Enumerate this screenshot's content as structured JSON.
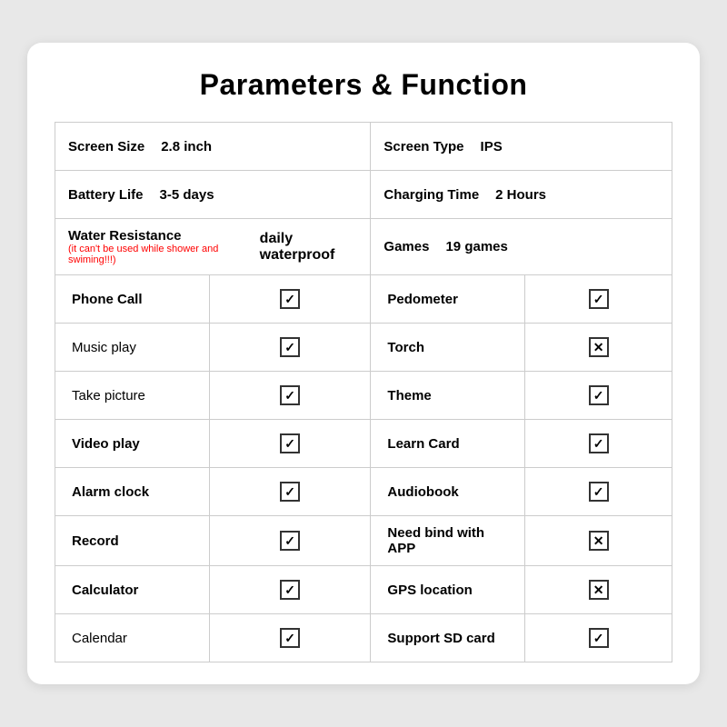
{
  "title": "Parameters & Function",
  "params": [
    {
      "left_label": "Screen Size",
      "left_value": "2.8 inch",
      "right_label": "Screen Type",
      "right_value": "IPS"
    },
    {
      "left_label": "Battery Life",
      "left_value": "3-5 days",
      "right_label": "Charging Time",
      "right_value": "2 Hours"
    },
    {
      "left_label": "Water Resistance",
      "left_value": "daily waterproof",
      "left_note": "(it can't be used while shower and swiming!!!)",
      "right_label": "Games",
      "right_value": "19 games"
    }
  ],
  "features": [
    {
      "left_label": "Phone Call",
      "left_bold": true,
      "left_check": "checked",
      "right_label": "Pedometer",
      "right_bold": true,
      "right_check": "checked"
    },
    {
      "left_label": "Music play",
      "left_bold": false,
      "left_check": "checked",
      "right_label": "Torch",
      "right_bold": true,
      "right_check": "cross"
    },
    {
      "left_label": "Take picture",
      "left_bold": false,
      "left_check": "checked",
      "right_label": "Theme",
      "right_bold": true,
      "right_check": "checked"
    },
    {
      "left_label": "Video play",
      "left_bold": true,
      "left_check": "checked",
      "right_label": "Learn Card",
      "right_bold": true,
      "right_check": "checked"
    },
    {
      "left_label": "Alarm clock",
      "left_bold": true,
      "left_check": "checked",
      "right_label": "Audiobook",
      "right_bold": true,
      "right_check": "checked"
    },
    {
      "left_label": "Record",
      "left_bold": true,
      "left_check": "checked",
      "right_label": "Need bind with APP",
      "right_bold": true,
      "right_check": "cross"
    },
    {
      "left_label": "Calculator",
      "left_bold": true,
      "left_check": "checked",
      "right_label": "GPS location",
      "right_bold": true,
      "right_check": "cross"
    },
    {
      "left_label": "Calendar",
      "left_bold": false,
      "left_check": "checked",
      "right_label": "Support SD card",
      "right_bold": true,
      "right_check": "checked"
    }
  ]
}
